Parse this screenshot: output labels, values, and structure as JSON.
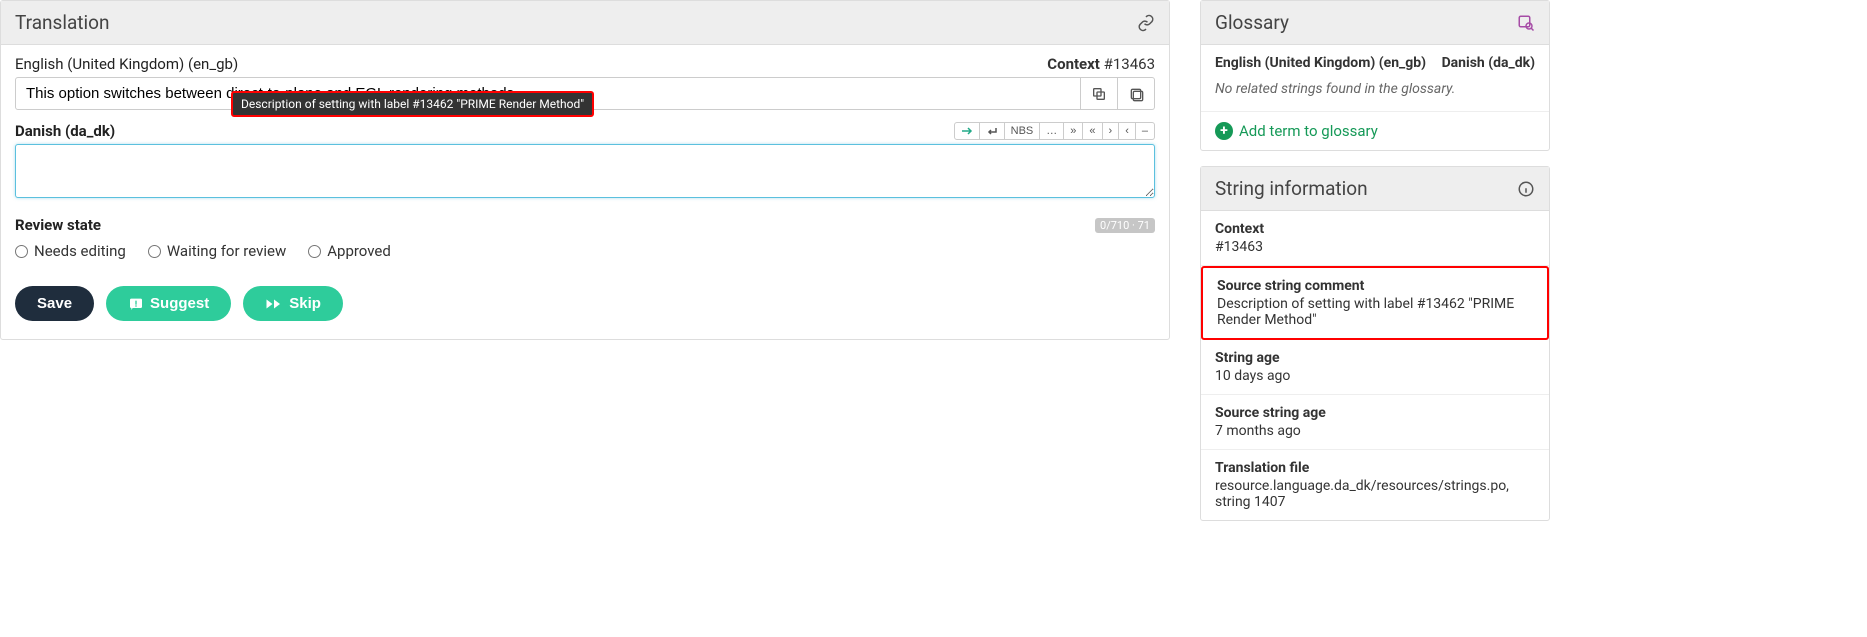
{
  "translation": {
    "header": "Translation",
    "source_lang": "English (United Kingdom) (en_gb)",
    "tooltip": "Description of setting with label #13462 \"PRIME Render Method\"",
    "context_label": "Context",
    "context_id": "#13463",
    "source_text": "This option switches between direct-to-plane and EGL rendering methods.",
    "target_lang": "Danish (da_dk)",
    "target_text": "",
    "nbs": "NBS",
    "ellipsis": "…",
    "raquo": "»",
    "laquo": "«",
    "rsaquo": "›",
    "lsaquo": "‹",
    "ndash": "–",
    "review_label": "Review state",
    "counter": "0/710 · 71",
    "radio_needs": "Needs editing",
    "radio_waiting": "Waiting for review",
    "radio_approved": "Approved",
    "btn_save": "Save",
    "btn_suggest": "Suggest",
    "btn_skip": "Skip"
  },
  "glossary": {
    "header": "Glossary",
    "lang_a": "English (United Kingdom) (en_gb)",
    "lang_b": "Danish (da_dk)",
    "empty": "No related strings found in the glossary.",
    "add": "Add term to glossary"
  },
  "stringinfo": {
    "header": "String information",
    "context_label": "Context",
    "context_id": "#13463",
    "comment_label": "Source string comment",
    "comment_text": "Description of setting with label #13462 \"PRIME Render Method\"",
    "age_label": "String age",
    "age_text": "10 days ago",
    "src_age_label": "Source string age",
    "src_age_text": "7 months ago",
    "file_label": "Translation file",
    "file_text": "resource.language.da_dk/resources/strings.po, string 1407"
  }
}
